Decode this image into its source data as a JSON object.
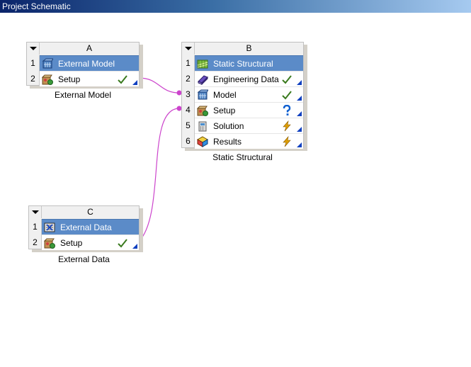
{
  "window": {
    "title": "Project Schematic"
  },
  "systems": {
    "A": {
      "letter": "A",
      "caption": "External Model",
      "rows": [
        {
          "num": "1",
          "label": "External Model"
        },
        {
          "num": "2",
          "label": "Setup"
        }
      ]
    },
    "B": {
      "letter": "B",
      "caption": "Static Structural",
      "rows": [
        {
          "num": "1",
          "label": "Static Structural"
        },
        {
          "num": "2",
          "label": "Engineering Data"
        },
        {
          "num": "3",
          "label": "Model"
        },
        {
          "num": "4",
          "label": "Setup"
        },
        {
          "num": "5",
          "label": "Solution"
        },
        {
          "num": "6",
          "label": "Results"
        }
      ]
    },
    "C": {
      "letter": "C",
      "caption": "External Data",
      "rows": [
        {
          "num": "1",
          "label": "External Data"
        },
        {
          "num": "2",
          "label": "Setup"
        }
      ]
    }
  },
  "colors": {
    "selected_row": "#5b8bc8",
    "link": "#cc44cc",
    "check": "#3a7a1e",
    "refresh": "#e0a000",
    "question": "#1060d0"
  }
}
